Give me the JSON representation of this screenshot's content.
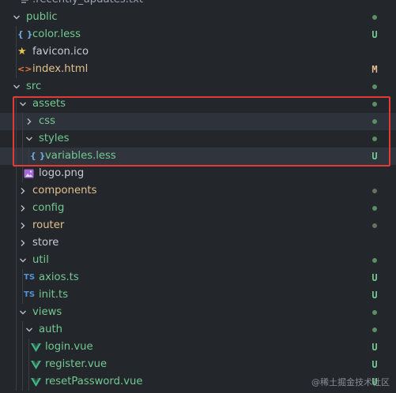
{
  "colors": {
    "background": "#23262b",
    "untracked": "#73c991",
    "modified": "#e2c08d",
    "dot": "#5a8f66",
    "dot_dim": "#6b6f63",
    "highlight": "#e23b36"
  },
  "tree": [
    {
      "label": ".recently_updates.txt",
      "icon": "text-file-icon",
      "badge": ""
    },
    {
      "label": "public",
      "icon": "chevron-down-icon",
      "badge": "dot"
    },
    {
      "label": "color.less",
      "icon": "braces-icon",
      "badge": "U"
    },
    {
      "label": "favicon.ico",
      "icon": "star-icon",
      "badge": ""
    },
    {
      "label": "index.html",
      "icon": "code-icon",
      "badge": "M"
    },
    {
      "label": "src",
      "icon": "chevron-down-icon",
      "badge": "dot"
    },
    {
      "label": "assets",
      "icon": "chevron-down-icon",
      "badge": "dot"
    },
    {
      "label": "css",
      "icon": "chevron-right-icon",
      "badge": "dot"
    },
    {
      "label": "styles",
      "icon": "chevron-down-icon",
      "badge": "dot"
    },
    {
      "label": "variables.less",
      "icon": "braces-icon",
      "badge": "U"
    },
    {
      "label": "logo.png",
      "icon": "image-icon",
      "badge": ""
    },
    {
      "label": "components",
      "icon": "chevron-right-icon",
      "badge": "dot"
    },
    {
      "label": "config",
      "icon": "chevron-right-icon",
      "badge": "dot"
    },
    {
      "label": "router",
      "icon": "chevron-right-icon",
      "badge": "dot"
    },
    {
      "label": "store",
      "icon": "chevron-right-icon",
      "badge": ""
    },
    {
      "label": "util",
      "icon": "chevron-down-icon",
      "badge": "dot"
    },
    {
      "label": "axios.ts",
      "icon": "typescript-icon",
      "badge": "U"
    },
    {
      "label": "init.ts",
      "icon": "typescript-icon",
      "badge": "U"
    },
    {
      "label": "views",
      "icon": "chevron-down-icon",
      "badge": "dot"
    },
    {
      "label": "auth",
      "icon": "chevron-down-icon",
      "badge": "dot"
    },
    {
      "label": "login.vue",
      "icon": "vue-icon",
      "badge": "U"
    },
    {
      "label": "register.vue",
      "icon": "vue-icon",
      "badge": "U"
    },
    {
      "label": "resetPassword.vue",
      "icon": "vue-icon",
      "badge": "U"
    }
  ],
  "icon_glyphs": {
    "braces": "{ }",
    "code": "<>",
    "typescript": "TS"
  },
  "watermark": "@稀土掘金技术社区"
}
